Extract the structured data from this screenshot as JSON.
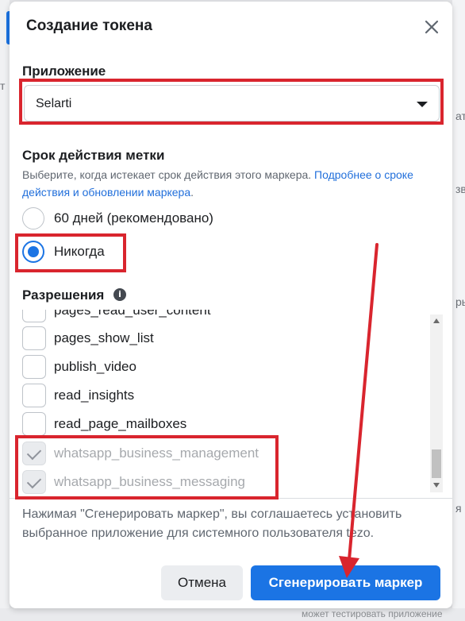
{
  "dialog": {
    "title": "Создание токена"
  },
  "application": {
    "label": "Приложение",
    "selected": "Selarti"
  },
  "expiry": {
    "label": "Срок действия метки",
    "description": "Выберите, когда истекает срок действия этого маркера. ",
    "link_text": "Подробнее о сроке действия и обновлении маркера",
    "link_tail": ".",
    "options": [
      {
        "label": "60 дней (рекомендовано)",
        "selected": false
      },
      {
        "label": "Никогда",
        "selected": true
      }
    ]
  },
  "permissions": {
    "label": "Разрешения",
    "info_icon_glyph": "i",
    "items": [
      {
        "label": "pages_read_user_content",
        "checked": false,
        "disabled": false
      },
      {
        "label": "pages_show_list",
        "checked": false,
        "disabled": false
      },
      {
        "label": "publish_video",
        "checked": false,
        "disabled": false
      },
      {
        "label": "read_insights",
        "checked": false,
        "disabled": false
      },
      {
        "label": "read_page_mailboxes",
        "checked": false,
        "disabled": false
      },
      {
        "label": "whatsapp_business_management",
        "checked": true,
        "disabled": true
      },
      {
        "label": "whatsapp_business_messaging",
        "checked": true,
        "disabled": true
      }
    ]
  },
  "consent_text": "Нажимая \"Сгенерировать маркер\", вы соглашаетесь установить выбранное приложение для системного пользователя tezo.",
  "buttons": {
    "cancel": "Отмена",
    "generate": "Сгенерировать маркер"
  },
  "background": {
    "right_fragments": [
      "т",
      "ат",
      "зв",
      "ры",
      "я"
    ],
    "left_fragments": [
      "т"
    ],
    "bottom_text": "может тестировать приложение"
  },
  "colors": {
    "accent": "#1b74e4",
    "annotation_red": "#d9252e"
  },
  "icons": {
    "close": "close-icon",
    "dropdown": "caret-down-icon",
    "info": "info-icon",
    "check": "check-icon"
  }
}
